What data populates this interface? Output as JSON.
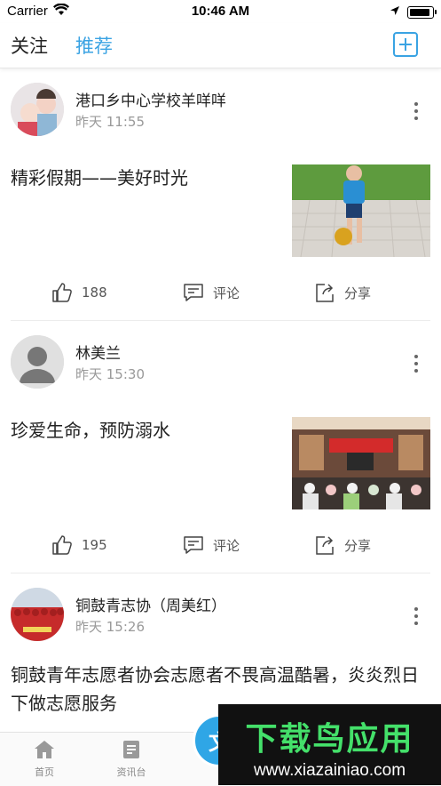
{
  "status": {
    "carrier": "Carrier",
    "time": "10:46 AM"
  },
  "nav": {
    "tab_follow": "关注",
    "tab_recommend": "推荐",
    "active_tab": "推荐",
    "accent": "#3aa3e3"
  },
  "posts": [
    {
      "author": "港口乡中心学校羊咩咩",
      "time": "昨天 11:55",
      "title": "精彩假期——美好时光",
      "likes": "188",
      "comment_label": "评论",
      "share_label": "分享"
    },
    {
      "author": "林美兰",
      "time": "昨天 15:30",
      "title": "珍爱生命，预防溺水",
      "likes": "195",
      "comment_label": "评论",
      "share_label": "分享"
    },
    {
      "author": "铜鼓青志协（周美红）",
      "time": "昨天 15:26",
      "title": "铜鼓青年志愿者协会志愿者不畏高温酷暑，炎炎烈日下做志愿服务"
    }
  ],
  "tabbar": {
    "home": "首页",
    "news": "资讯台",
    "center_icon_text": "文"
  },
  "watermark": {
    "title": "下载鸟应用",
    "url": "www.xiazainiao.com"
  }
}
